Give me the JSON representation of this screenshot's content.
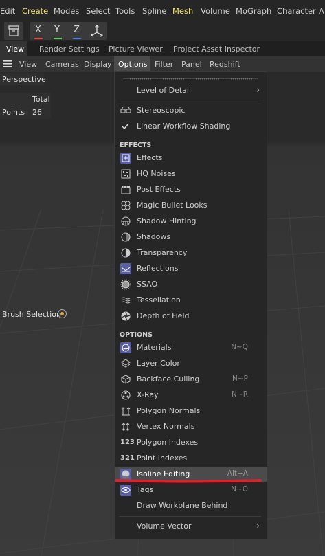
{
  "menubar": {
    "items": [
      "Edit",
      "Create",
      "Modes",
      "Select",
      "Tools",
      "Spline",
      "Mesh",
      "Volume",
      "MoGraph",
      "Character",
      "A"
    ],
    "highlighted": [
      "Create",
      "Mesh"
    ]
  },
  "toolbar": {
    "axes": [
      "X",
      "Y",
      "Z"
    ],
    "axis_colors": [
      "#e04a4a",
      "#5fcf5f",
      "#4a7fe0"
    ]
  },
  "tabs": [
    "View",
    "Render Settings",
    "Picture Viewer",
    "Project Asset Inspector"
  ],
  "viewport_menu": {
    "items": [
      "View",
      "Cameras",
      "Display",
      "Options",
      "Filter",
      "Panel",
      "Redshift"
    ],
    "active": "Options"
  },
  "viewport": {
    "camera": "Perspective",
    "stats_header": "Total",
    "stats_label": "Points",
    "stats_value": "26",
    "brush_label": "Brush Selection"
  },
  "popup": {
    "level_of_detail": "Level of Detail",
    "stereoscopic": "Stereoscopic",
    "linear_workflow": "Linear Workflow Shading",
    "effects_header": "EFFECTS",
    "effects": [
      "Effects",
      "HQ Noises",
      "Post Effects",
      "Magic Bullet Looks",
      "Shadow Hinting",
      "Shadows",
      "Transparency",
      "Reflections",
      "SSAO",
      "Tessellation",
      "Depth of Field"
    ],
    "options_header": "OPTIONS",
    "options": [
      {
        "label": "Materials",
        "shortcut": "N~Q"
      },
      {
        "label": "Layer Color",
        "shortcut": ""
      },
      {
        "label": "Backface Culling",
        "shortcut": "N~P"
      },
      {
        "label": "X-Ray",
        "shortcut": "N~R"
      },
      {
        "label": "Polygon Normals",
        "shortcut": ""
      },
      {
        "label": "Vertex Normals",
        "shortcut": ""
      },
      {
        "label": "Polygon Indexes",
        "shortcut": ""
      },
      {
        "label": "Point Indexes",
        "shortcut": ""
      },
      {
        "label": "Isoline Editing",
        "shortcut": "Alt+A"
      },
      {
        "label": "Tags",
        "shortcut": "N~O"
      },
      {
        "label": "Draw Workplane Behind",
        "shortcut": ""
      }
    ],
    "volume_vector": "Volume Vector",
    "selected_item": "Isoline Editing",
    "underline_color": "#e0202a"
  }
}
